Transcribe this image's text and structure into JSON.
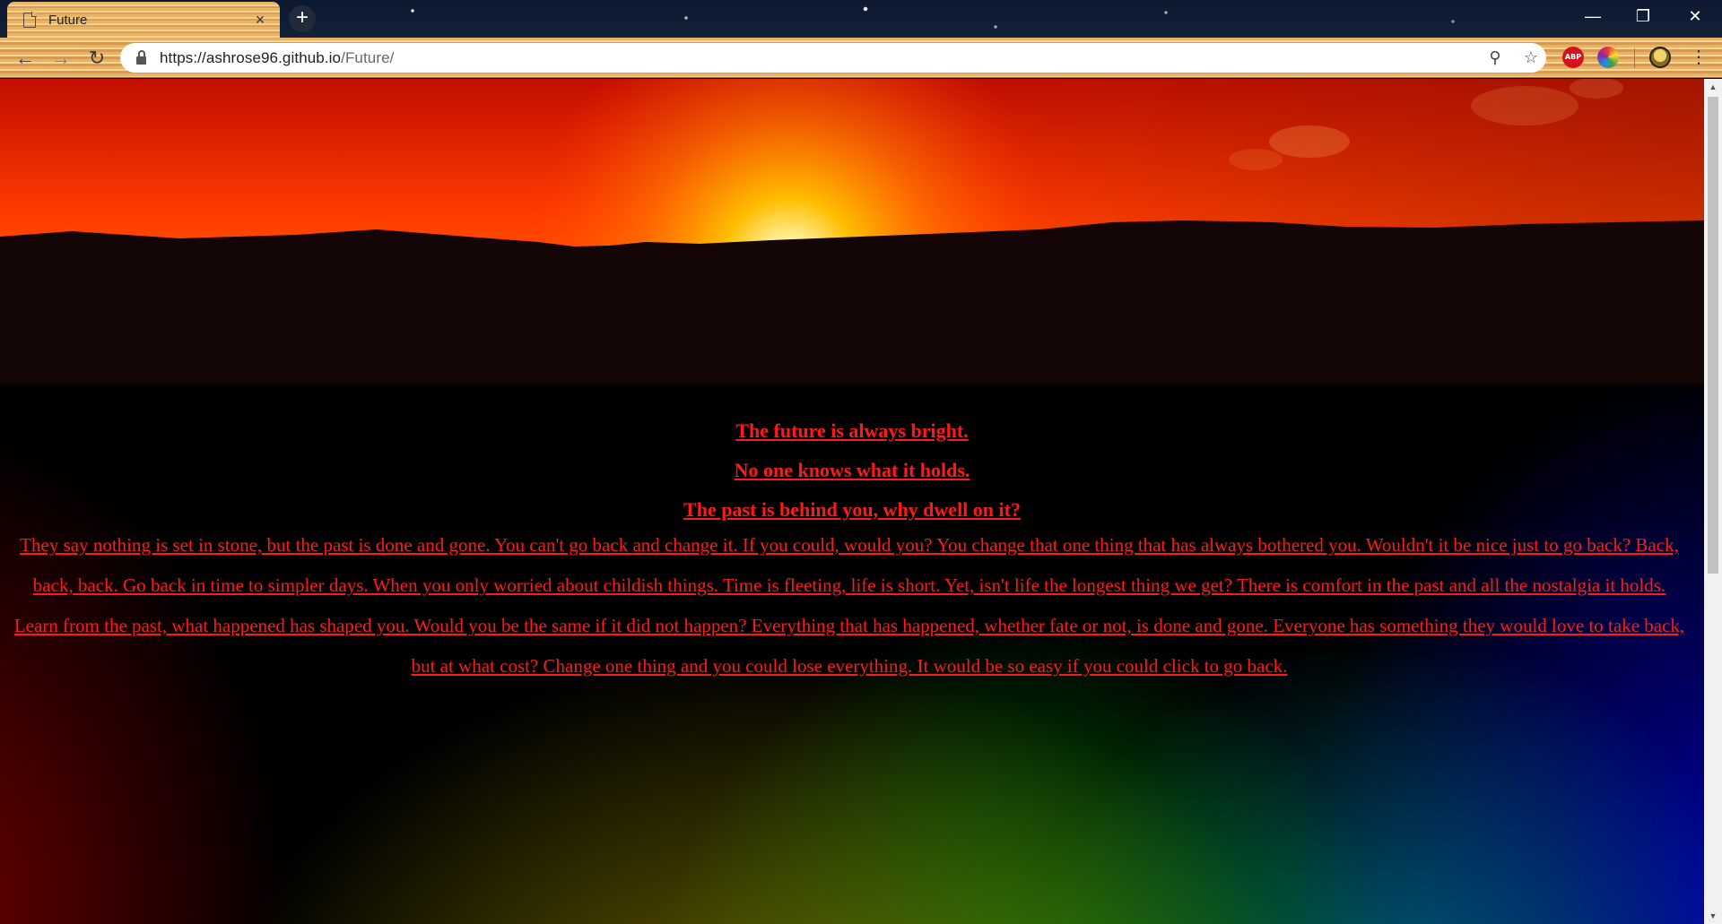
{
  "browser": {
    "tab": {
      "title": "Future",
      "favicon": "page-icon",
      "close": "×"
    },
    "new_tab": "+",
    "window_controls": {
      "minimize": "—",
      "restore": "❐",
      "close": "✕"
    },
    "toolbar": {
      "back": "←",
      "forward": "→",
      "reload": "↻",
      "zoom": "⚲",
      "bookmark": "☆",
      "menu": "⋮"
    },
    "url": {
      "host": "https://ashrose96.github.io",
      "path": "/Future/"
    },
    "extensions": {
      "abp": "ABP"
    },
    "colors": {
      "tab": "#f2c57a",
      "titlebar": "#0c1830"
    }
  },
  "page": {
    "line1": "The future is always bright.",
    "line2": "No one knows what it holds.",
    "line3": "The past is behind you, why dwell on it?",
    "paragraph": "They say nothing is set in stone, but the past is done and gone. You can't go back and change it. If you could, would you? You change that one thing that has always bothered you. Wouldn't it be nice just to go back? Back, back, back. Go back in time to simpler days. When you only worried about childish things. Time is fleeting, life is short. Yet, isn't life the longest thing we get? There is comfort in the past and all the nostalgia it holds. Learn from the past, what happened has shaped you. Would you be the same if it did not happen? Everything that has happened, whether fate or not, is done and gone. Everyone has something they would love to take back, but at what cost? Change one thing and you could lose everything. It would be so easy if you could click to go back.",
    "colors": {
      "text": "#ff1a1a",
      "background": "#000000"
    }
  },
  "scrollbar": {
    "up": "▲",
    "down": "▼"
  }
}
